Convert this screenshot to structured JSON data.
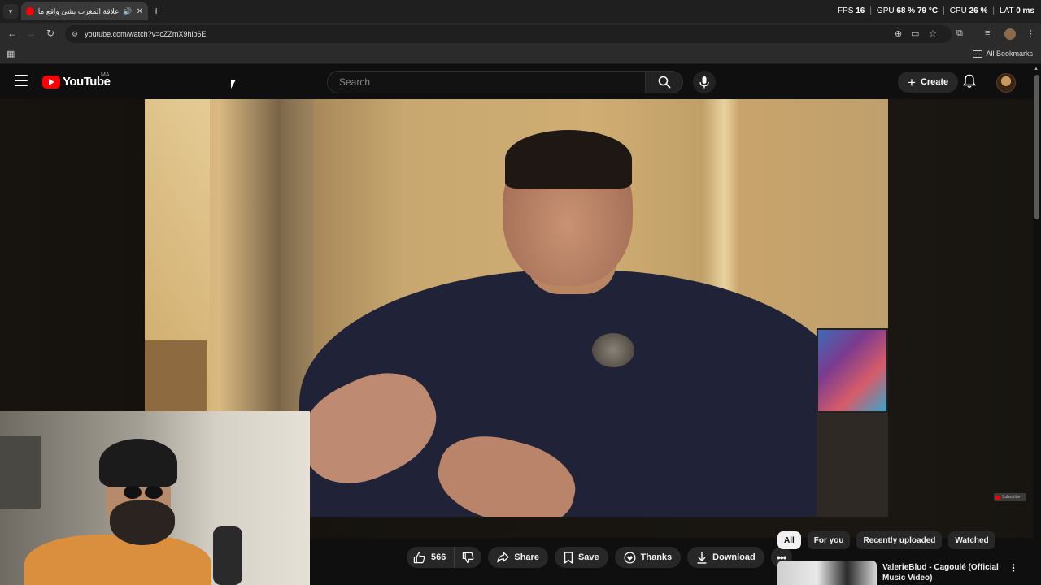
{
  "browser": {
    "tab": {
      "title": "علاقة المغرب بشئ واقع ما ي..."
    },
    "url": "youtube.com/watch?v=cZZmX9hlb6E",
    "bookmarks_label": "All Bookmarks",
    "overlay": {
      "fps_label": "FPS",
      "fps_value": "16",
      "gpu_label": "GPU",
      "gpu_value": "68 % 79 °C",
      "cpu_label": "CPU",
      "cpu_value": "26 %",
      "lat_label": "LAT",
      "lat_value": "0 ms"
    }
  },
  "youtube": {
    "logo_text": "YouTube",
    "country_code": "MA",
    "search_placeholder": "Search",
    "create_label": "Create"
  },
  "actions": {
    "like_count": "566",
    "share": "Share",
    "save": "Save",
    "thanks": "Thanks",
    "download": "Download"
  },
  "chips": [
    "All",
    "For you",
    "Recently uploaded",
    "Watched"
  ],
  "recommendation": {
    "title": "ValerieBlud - Cagoulé (Official Music Video)"
  },
  "watermark_label": "Subscribe",
  "colors": {
    "brand_red": "#ff0000",
    "background": "#0f0f0f",
    "pill": "#272727"
  }
}
